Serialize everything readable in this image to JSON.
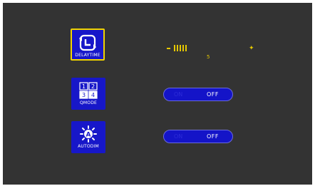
{
  "menu": {
    "items": [
      {
        "label": "DELAYTIME",
        "icon": "delay-clock-icon",
        "selected": true
      },
      {
        "label": "QMODE",
        "icon": "quad-grid-icon",
        "selected": false,
        "grid": [
          "1",
          "2",
          "3",
          "4"
        ]
      },
      {
        "label": "AUTODIM",
        "icon": "auto-dim-sun-icon",
        "selected": false,
        "glyph_letter": "A"
      }
    ]
  },
  "delay_slider": {
    "minus_symbol": "−",
    "plus_symbol": "+",
    "value": "5"
  },
  "qmode_toggle": {
    "on_label": "ON",
    "off_label": "OFF",
    "state": "OFF"
  },
  "autodim_toggle": {
    "on_label": "ON",
    "off_label": "OFF",
    "state": "OFF"
  },
  "colors": {
    "background": "#333333",
    "icon_blue": "#1717c9",
    "selection": "#f1d400",
    "slider_yellow": "#e6c800"
  }
}
